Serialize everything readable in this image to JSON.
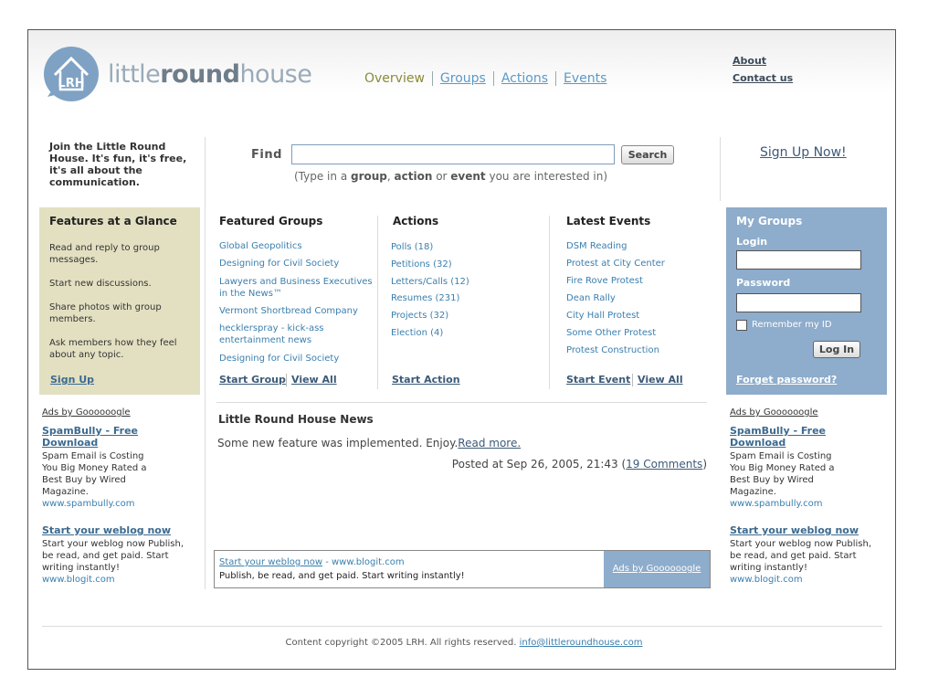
{
  "header": {
    "logo_part1": "little",
    "logo_part2": "round",
    "logo_part3": "house",
    "logo_mark": "LRH",
    "nav": [
      "Overview",
      "Groups",
      "Actions",
      "Events"
    ],
    "top_links": [
      "About",
      "Contact us"
    ]
  },
  "join_text": "Join the Little Round House. It's fun, it's free, it's all about the communication.",
  "search": {
    "label": "Find",
    "value": "",
    "button": "Search",
    "hint_parts": [
      "(Type in a ",
      "group",
      ", ",
      "action",
      " or ",
      "event",
      " you are interested in)"
    ]
  },
  "signup_now": "Sign Up Now!",
  "features": {
    "title": "Features at a Glance",
    "items": [
      "Read and reply to group messages.",
      "Start new discussions.",
      "Share photos with group members.",
      "Ask members how they feel about any topic."
    ],
    "signup": "Sign Up"
  },
  "featured_groups": {
    "title": "Featured Groups",
    "items": [
      "Global Geopolitics",
      "Designing for Civil Society",
      "Lawyers and Business Executives in the News™",
      "Vermont Shortbread Company",
      "hecklerspray - kick-ass entertainment news",
      "Designing for Civil Society"
    ],
    "start": "Start Group",
    "view_all": "View All"
  },
  "actions": {
    "title": "Actions",
    "items": [
      "Polls (18)",
      "Petitions (32)",
      "Letters/Calls (12)",
      "Resumes (231)",
      "Projects (32)",
      "Election (4)"
    ],
    "start": "Start Action"
  },
  "latest_events": {
    "title": "Latest Events",
    "items": [
      "DSM Reading",
      "Protest at City Center",
      "Fire Rove Protest",
      "Dean Rally",
      "City Hall Protest",
      "Some Other Protest",
      "Protest Construction"
    ],
    "start": "Start Event",
    "view_all": "View All"
  },
  "news": {
    "title": "Little Round House News",
    "body": "Some new feature was implemented. Enjoy.",
    "read_more": "Read more.",
    "posted": "Posted at Sep 26, 2005, 21:43 (",
    "comments": "19 Comments",
    "close_paren": ")"
  },
  "bottom_ad": {
    "title": "Start your weblog now",
    "url": " - www.blogit.com",
    "text": "Publish, be read, and get paid. Start writing instantly!",
    "ads_by": "Ads by Goooooogle"
  },
  "my_groups": {
    "title": "My Groups",
    "login_label": "Login",
    "login_value": "",
    "password_label": "Password",
    "password_value": "",
    "remember": "Remember my ID",
    "login_button": "Log In",
    "forgot": "Forget password?"
  },
  "side_ads": {
    "ads_by": "Ads by Goooooogle",
    "ad1_title": "SpamBully - Free Download",
    "ad1_text": "Spam Email is Costing You Big Money Rated a Best Buy by Wired Magazine.",
    "ad1_url": "www.spambully.com",
    "ad2_title": "Start your weblog now",
    "ad2_text": "Start your weblog now Publish, be read, and get paid. Start writing instantly!",
    "ad2_url": "www.blogit.com"
  },
  "footer": {
    "text": "Content copyright ©2005 LRH. All rights reserved. ",
    "email": "info@littleroundhouse.com"
  }
}
